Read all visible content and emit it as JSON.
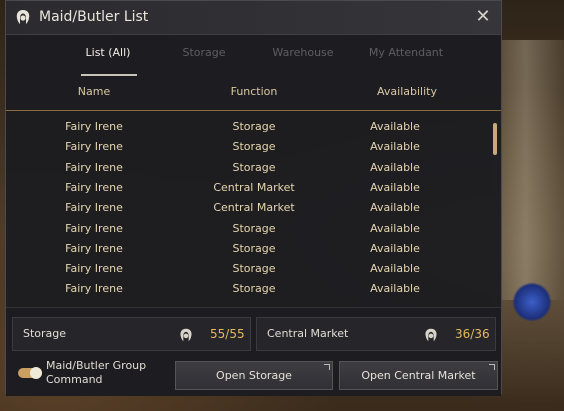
{
  "window": {
    "title": "Maid/Butler List"
  },
  "tabs": [
    {
      "label": "List (All)",
      "active": true
    },
    {
      "label": "Storage",
      "active": false
    },
    {
      "label": "Warehouse",
      "active": false
    },
    {
      "label": "My Attendant",
      "active": false
    }
  ],
  "columns": {
    "name": "Name",
    "function": "Function",
    "availability": "Availability"
  },
  "rows": [
    {
      "name": "Fairy Irene",
      "function": "Storage",
      "availability": "Available"
    },
    {
      "name": "Fairy Irene",
      "function": "Storage",
      "availability": "Available"
    },
    {
      "name": "Fairy Irene",
      "function": "Storage",
      "availability": "Available"
    },
    {
      "name": "Fairy Irene",
      "function": "Central Market",
      "availability": "Available"
    },
    {
      "name": "Fairy Irene",
      "function": "Central Market",
      "availability": "Available"
    },
    {
      "name": "Fairy Irene",
      "function": "Storage",
      "availability": "Available"
    },
    {
      "name": "Fairy Irene",
      "function": "Storage",
      "availability": "Available"
    },
    {
      "name": "Fairy Irene",
      "function": "Storage",
      "availability": "Available"
    },
    {
      "name": "Fairy Irene",
      "function": "Storage",
      "availability": "Available"
    }
  ],
  "summary": {
    "storage": {
      "label": "Storage",
      "count": "55/55"
    },
    "market": {
      "label": "Central Market",
      "count": "36/36"
    }
  },
  "group_command": {
    "label": "Maid/Butler Group Command",
    "enabled": true
  },
  "buttons": {
    "open_storage": "Open Storage",
    "open_market": "Open Central Market"
  },
  "colors": {
    "accent": "#e5b95a",
    "row_text": "#e6d6b0",
    "header_text": "#d9c8a4",
    "divider": "#8a6b3d"
  },
  "icons": {
    "title": "maid-icon",
    "close": "close-icon",
    "count": "maid-icon"
  }
}
